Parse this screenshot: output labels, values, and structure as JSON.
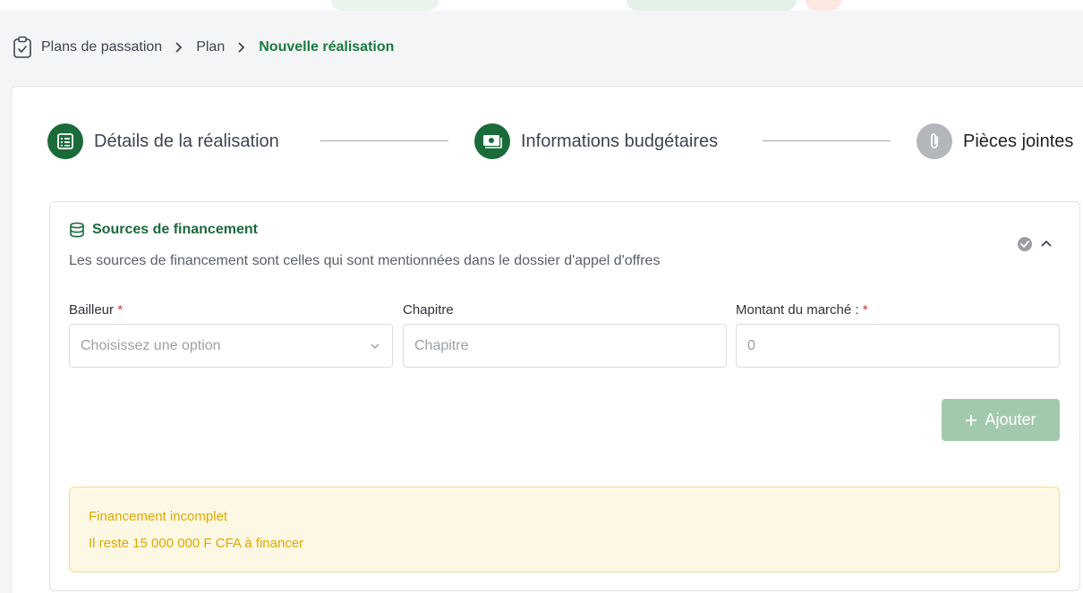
{
  "breadcrumb": {
    "items": [
      "Plans de passation",
      "Plan"
    ],
    "current": "Nouvelle réalisation"
  },
  "stepper": {
    "steps": [
      {
        "label": "Détails de la réalisation",
        "state": "active",
        "icon": "list-icon"
      },
      {
        "label": "Informations budgétaires",
        "state": "active",
        "icon": "money-icon"
      },
      {
        "label": "Pièces jointes",
        "state": "pending",
        "icon": "paperclip-icon"
      }
    ]
  },
  "panel": {
    "title": "Sources de financement",
    "subtitle": "Les sources de financement sont celles qui sont mentionnées dans le dossier d'appel d'offres",
    "icon": "database-icon"
  },
  "form": {
    "bailleur_label": "Bailleur",
    "bailleur_placeholder": "Choisissez une option",
    "chapitre_label": "Chapitre",
    "chapitre_placeholder": "Chapitre",
    "montant_label": "Montant du marché :",
    "montant_placeholder": "0",
    "required_mark": "*"
  },
  "add_button": {
    "label": "Ajouter"
  },
  "alert": {
    "title": "Financement incomplet",
    "text": "Il reste 15 000 000 F CFA à financer"
  },
  "colors": {
    "primary": "#1a6b3a",
    "primary_light": "#a3c9ad",
    "warning": "#e0a800",
    "warning_bg": "#fdf8e4",
    "required": "#d9302c"
  }
}
